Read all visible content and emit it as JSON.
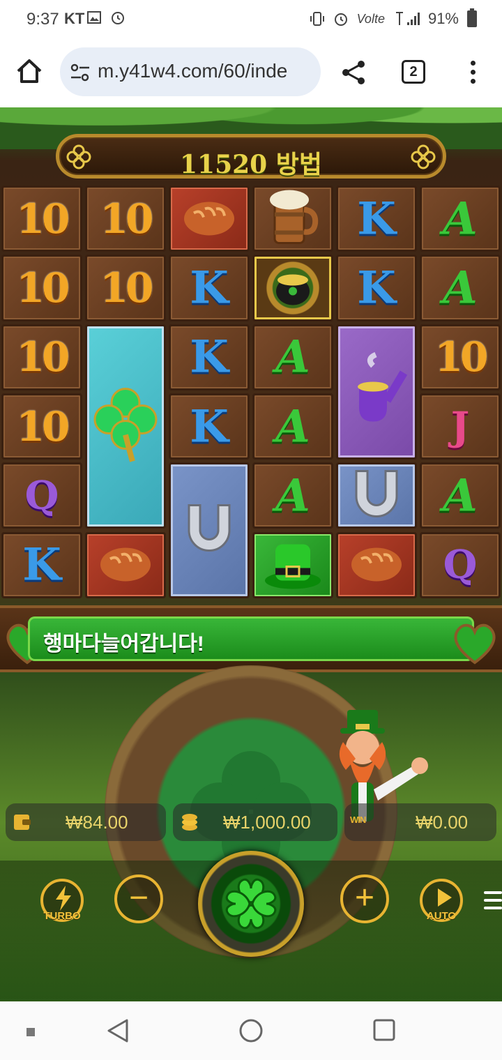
{
  "status_bar": {
    "time": "9:37",
    "carrier": "KT",
    "battery": "91%",
    "icons": [
      "vibrate-icon",
      "alarm-icon",
      "volte-icon",
      "lte-icon",
      "signal-icon",
      "battery-icon"
    ]
  },
  "browser": {
    "url": "m.y41w4.com/60/inde",
    "tab_count": "2"
  },
  "game": {
    "ways_text": "11520 방법",
    "message": "행마다늘어갑니다!",
    "grid": [
      [
        "10",
        "10",
        "bread",
        "beer-mug",
        "K",
        "A"
      ],
      [
        "10",
        "10",
        "K",
        "pot-of-gold",
        "K",
        "A"
      ],
      [
        "10",
        "clover",
        "K",
        "A",
        "pipe",
        "10"
      ],
      [
        "10",
        "clover",
        "K",
        "A",
        "pipe",
        "J"
      ],
      [
        "Q",
        "clover",
        "horseshoe",
        "A",
        "horseshoe",
        "A"
      ],
      [
        "K",
        "bread",
        "horseshoe",
        "hat",
        "bread",
        "Q"
      ]
    ],
    "bet_amount": "₩84.00",
    "balance": "₩1,000.00",
    "win_amount": "₩0.00",
    "win_label": "WIN",
    "turbo_label": "TURBO",
    "auto_label": "AUTO",
    "minus": "−",
    "plus": "+",
    "colors": {
      "accent_gold": "#f2c23a",
      "message_green": "#2aa82a",
      "amount_text": "#e8d36a"
    }
  }
}
